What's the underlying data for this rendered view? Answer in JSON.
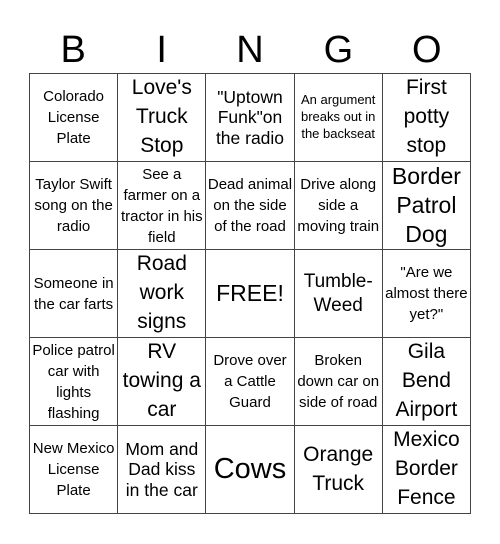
{
  "title_letters": [
    "B",
    "I",
    "N",
    "G",
    "O"
  ],
  "card": {
    "rows": [
      [
        {
          "text": "Colorado License Plate",
          "size": "s"
        },
        {
          "text": "Love's Truck Stop",
          "size": "l"
        },
        {
          "text": "\"Uptown Funk\"on the radio",
          "size": "m"
        },
        {
          "text": "An argument breaks out in the backseat",
          "size": "xs"
        },
        {
          "text": "First potty stop",
          "size": "l"
        }
      ],
      [
        {
          "text": "Taylor Swift song on the radio",
          "size": "s"
        },
        {
          "text": "See a farmer on a tractor in his field",
          "size": "s"
        },
        {
          "text": "Dead animal on the side of the road",
          "size": "s"
        },
        {
          "text": "Drive along side a moving train",
          "size": "s"
        },
        {
          "text": "Border Patrol Dog",
          "size": "xl"
        }
      ],
      [
        {
          "text": "Someone in the car farts",
          "size": "s"
        },
        {
          "text": "Road work signs",
          "size": "l"
        },
        {
          "text": "FREE!",
          "size": "xl",
          "free": true
        },
        {
          "text": "Tumble-Weed",
          "size": "ml"
        },
        {
          "text": "\"Are we almost there yet?\"",
          "size": "s"
        }
      ],
      [
        {
          "text": "Police patrol car with lights flashing",
          "size": "s"
        },
        {
          "text": "RV towing a car",
          "size": "l"
        },
        {
          "text": "Drove over a Cattle Guard",
          "size": "s"
        },
        {
          "text": "Broken down car on side of road",
          "size": "s"
        },
        {
          "text": "Gila Bend Airport",
          "size": "l"
        }
      ],
      [
        {
          "text": "New Mexico License Plate",
          "size": "s"
        },
        {
          "text": "Mom and Dad kiss in the car",
          "size": "m"
        },
        {
          "text": "Cows",
          "size": "xxl"
        },
        {
          "text": "Orange Truck",
          "size": "l"
        },
        {
          "text": "Mexico Border Fence",
          "size": "l"
        }
      ]
    ]
  }
}
